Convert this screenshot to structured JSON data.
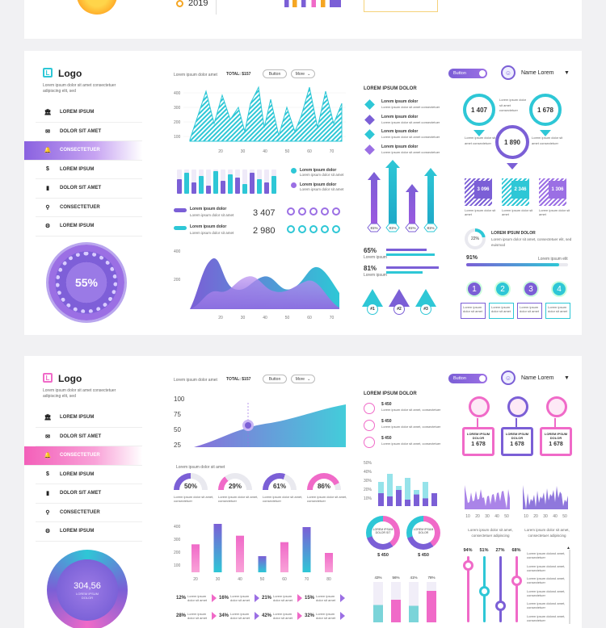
{
  "top_strip": {
    "year": "2019"
  },
  "panel1": {
    "logo_letter": "L",
    "logo": "Logo",
    "desc": "Lorem ipsum dolor sit amet consectetuer adipiscing elit, sed",
    "menu": [
      {
        "icon": "bank-icon",
        "glyph": "🏛",
        "label": "LOREM IPSUM"
      },
      {
        "icon": "mail-icon",
        "glyph": "✉",
        "label": "DOLOR SIT AMET"
      },
      {
        "icon": "bell-icon",
        "glyph": "🔔",
        "label": "CONSECTETUER"
      },
      {
        "icon": "dollar-icon",
        "glyph": "$",
        "label": "LOREM IPSUM"
      },
      {
        "icon": "chart-icon",
        "glyph": "▮",
        "label": "DOLOR SIT AMET"
      },
      {
        "icon": "search-icon",
        "glyph": "⚲",
        "label": "CONSECTETUER"
      },
      {
        "icon": "gear-icon",
        "glyph": "⚙",
        "label": "LOREM IPSUM"
      }
    ],
    "gauge_value": "55%",
    "header": {
      "text": "Lorem ipsum dolor amet",
      "total": "TOTAL: $157",
      "button": "Button",
      "more": "More"
    },
    "area_yticks": [
      "400",
      "300",
      "200",
      "100"
    ],
    "xticks": [
      "20",
      "30",
      "40",
      "50",
      "60",
      "70",
      "80"
    ],
    "legend": [
      {
        "label": "Lorem ipsum dolor",
        "sub": "Lorem ipsum dolor sit amet"
      },
      {
        "label": "Lorem ipsum dolor",
        "sub": "Lorem ipsum dolor sit amet"
      }
    ],
    "stats": [
      {
        "label": "Lorem ipsum dolor",
        "sub": "Lorem ipsum dolor sit amet",
        "value": "3 407"
      },
      {
        "label": "Lorem ipsum dolor",
        "sub": "Lorem ipsum dolor sit amet",
        "value": "2 980"
      }
    ],
    "wave_yticks": [
      "400",
      "200"
    ],
    "col3_title": "LOREM IPSUM DOLOR",
    "col3_items": [
      {
        "title": "Lorem ipsum dolor",
        "sub": "Lorem ipsum dolor sit amet consectetuer"
      },
      {
        "title": "Lorem ipsum dolor",
        "sub": "Lorem ipsum dolor sit amet consectetuer"
      },
      {
        "title": "Lorem ipsum dolor",
        "sub": "Lorem ipsum dolor sit amet consectetuer"
      },
      {
        "title": "Lorem ipsum dolor",
        "sub": "Lorem ipsum dolor sit amet consectetuer"
      }
    ],
    "arrow_pcts": [
      "81%",
      "81%",
      "81%",
      "81%"
    ],
    "bar_pcts": [
      {
        "value": "65%",
        "label": "Lorem ipsum"
      },
      {
        "value": "81%",
        "label": "Lorem ipsum"
      }
    ],
    "triangles": [
      "#1",
      "#2",
      "#3"
    ],
    "toggle": "Button",
    "user": "Name Lorem",
    "pins": [
      "1 407",
      "1 678",
      "1 890"
    ],
    "pin_text": "Lorem ipsum dolor sit amet consectetuer",
    "squares": [
      "3 096",
      "2 346",
      "1 306"
    ],
    "square_sub": "Lorem ipsum dolor sit amet",
    "ring_pct": "22%",
    "ring_title": "LOREM IPSUM DOLOR",
    "ring_sub": "Lorem ipsum dolor sit amet, consectetuer elit, sed euismod",
    "bar91": "91%",
    "bar91_label": "Lorem ipsum elit",
    "steps": [
      "1",
      "2",
      "3",
      "4"
    ]
  },
  "panel2": {
    "logo_letter": "L",
    "logo": "Logo",
    "desc": "Lorem ipsum dolor sit amet consectetuer adipiscing elit, sed",
    "menu": [
      {
        "icon": "bank-icon",
        "glyph": "🏛",
        "label": "LOREM IPSUM"
      },
      {
        "icon": "mail-icon",
        "glyph": "✉",
        "label": "DOLOR SIT AMET"
      },
      {
        "icon": "bell-icon",
        "glyph": "🔔",
        "label": "CONSECTETUER"
      },
      {
        "icon": "dollar-icon",
        "glyph": "$",
        "label": "LOREM IPSUM"
      },
      {
        "icon": "chart-icon",
        "glyph": "▮",
        "label": "DOLOR SIT AMET"
      },
      {
        "icon": "search-icon",
        "glyph": "⚲",
        "label": "CONSECTETUER"
      },
      {
        "icon": "gear-icon",
        "glyph": "⚙",
        "label": "LOREM IPSUM"
      }
    ],
    "gauge_value": "304,56",
    "gauge_sub": "LOREM IPSUM DOLOR",
    "header": {
      "text": "Lorem ipsum dolor amet",
      "total": "TOTAL: $157",
      "button": "Button",
      "more": "More"
    },
    "area_yticks": [
      "100",
      "75",
      "50",
      "25"
    ],
    "donut_title": "Lorem ipsum dolor sit amet",
    "donuts": [
      {
        "value": "50%",
        "sub": "Lorem ipsum dolor sit amet, consectetuer"
      },
      {
        "value": "29%",
        "sub": "Lorem ipsum dolor sit amet, consectetuer"
      },
      {
        "value": "61%",
        "sub": "Lorem ipsum dolor sit amet, consectetuer"
      },
      {
        "value": "86%",
        "sub": "Lorem ipsum dolor sit amet, consectetuer"
      }
    ],
    "bar_yticks": [
      "400",
      "300",
      "200",
      "100"
    ],
    "xticks": [
      "20",
      "30",
      "40",
      "50",
      "60",
      "70",
      "80"
    ],
    "pct_tags": [
      "12%",
      "16%",
      "21%",
      "15%",
      "28%",
      "34%",
      "42%",
      "32%"
    ],
    "pct_tag_sub": "Lorem ipsum dolor sit amet",
    "col3_title": "LOREM IPSUM DOLOR",
    "money": [
      {
        "value": "$ 450",
        "sub": "Lorem ipsum dolor sit amet, consectetuer"
      },
      {
        "value": "$ 450",
        "sub": "Lorem ipsum dolor sit amet, consectetuer"
      },
      {
        "value": "$ 450",
        "sub": "Lorem ipsum dolor sit amet, consectetuer"
      }
    ],
    "stack_yticks": [
      "50%",
      "40%",
      "30%",
      "20%",
      "10%"
    ],
    "rings": [
      {
        "label": "LOREM IPSUM DOLOR SIT",
        "value": "$ 450"
      },
      {
        "label": "LOREM IPSUM DOLOR",
        "value": "$ 450"
      }
    ],
    "vbar_pcts": [
      "43%",
      "56%",
      "41%",
      "78%"
    ],
    "toggle": "Button",
    "user": "Name Lorem",
    "badges": [
      {
        "label": "LOREM IPSUM DOLOR",
        "value": "1 678"
      },
      {
        "label": "LOREM IPSUM DOLOR",
        "value": "1 678"
      },
      {
        "label": "LOREM IPSUM DOLOR",
        "value": "1 678"
      }
    ],
    "spark_xticks": [
      "10",
      "20",
      "30",
      "40",
      "50"
    ],
    "spark_sub": "Lorem ipsum dolor sit amet, consectetuer adipiscing",
    "slider_pcts": [
      "94%",
      "51%",
      "27%",
      "68%"
    ],
    "list_items": [
      "Lorem ipsum dolorol amet, consectetuer",
      "Lorem ipsum dolorol amet, consectetuer",
      "Lorem ipsum dolorol amet, consectetuer",
      "Lorem ipsum dolorol amet, consectetuer",
      "Lorem ipsum dolorol amet, consectetuer",
      "Lorem ipsum dolorol amet, consectetuer"
    ]
  },
  "colors": {
    "purple": "#7b5fd6",
    "cyan": "#2ec7d6",
    "pink": "#f06ac8",
    "violet": "#9b59e0"
  }
}
